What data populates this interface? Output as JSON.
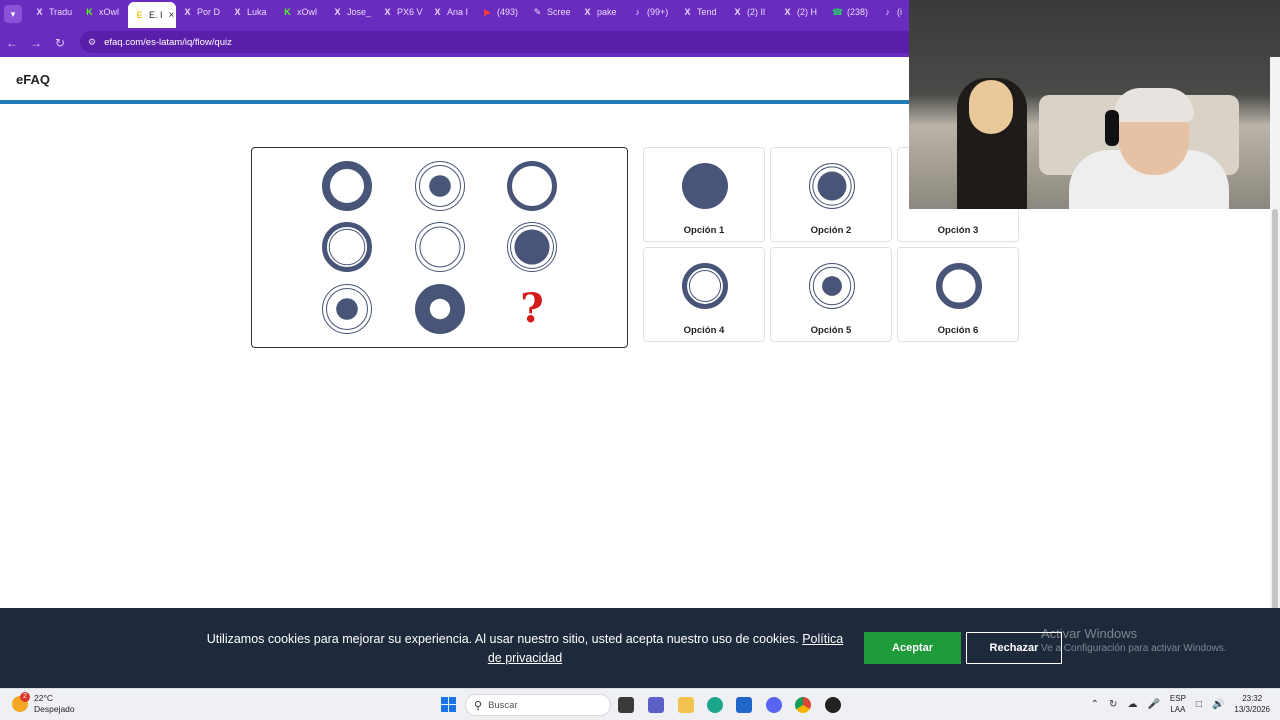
{
  "browser": {
    "tabs": [
      {
        "icon": "x-logo-icon",
        "label": "Tradu"
      },
      {
        "icon": "kick-logo-icon",
        "label": "xOwl"
      },
      {
        "icon": "efaq-logo-icon",
        "label": "E. I",
        "active": true
      },
      {
        "icon": "x-logo-icon",
        "label": "Por D"
      },
      {
        "icon": "x-logo-icon",
        "label": "Luka"
      },
      {
        "icon": "kick-logo-icon",
        "label": "xOwl"
      },
      {
        "icon": "x-logo-icon",
        "label": "Jose_"
      },
      {
        "icon": "x-logo-icon",
        "label": "PX6 V"
      },
      {
        "icon": "x-logo-icon",
        "label": "Ana I"
      },
      {
        "icon": "youtube-logo-icon",
        "label": "(493)"
      },
      {
        "icon": "pen-icon",
        "label": "Scree"
      },
      {
        "icon": "x-logo-icon",
        "label": "pake"
      },
      {
        "icon": "tiktok-logo-icon",
        "label": "(99+)"
      },
      {
        "icon": "x-logo-icon",
        "label": "Tend"
      },
      {
        "icon": "x-logo-icon",
        "label": "(2) Il"
      },
      {
        "icon": "x-logo-icon",
        "label": "(2) H"
      },
      {
        "icon": "whatsapp-logo-icon",
        "label": "(238)"
      },
      {
        "icon": "tiktok-logo-icon",
        "label": "(i"
      }
    ],
    "url": "efaq.com/es-latam/iq/flow/quiz"
  },
  "header": {
    "brand": "eFAQ"
  },
  "puzzle": {
    "cells": [
      {
        "outer": 50,
        "ring": 0.32,
        "inner_gap": 0,
        "core": 0
      },
      {
        "outer": 50,
        "ring": 0.04,
        "inner_gap": 0.1,
        "core": 0.48
      },
      {
        "outer": 50,
        "ring": 0.2,
        "inner_gap": 0,
        "core": 0
      },
      {
        "outer": 50,
        "ring": 0.2,
        "inner_gap": 0.05,
        "core": 0
      },
      {
        "outer": 50,
        "ring": 0.04,
        "inner_gap": 0.12,
        "core": 0
      },
      {
        "outer": 50,
        "ring": 0.04,
        "inner_gap": 0.06,
        "core": 0.78
      },
      {
        "outer": 50,
        "ring": 0.04,
        "inner_gap": 0.1,
        "core": 0.48
      },
      {
        "outer": 50,
        "ring": 1,
        "inner_gap": 0,
        "core": 0,
        "hole": 0.48
      },
      {
        "question": "?"
      }
    ]
  },
  "options": [
    {
      "label": "Opción 1"
    },
    {
      "label": "Opción 2"
    },
    {
      "label": "Opción 3"
    },
    {
      "label": "Opción 4"
    },
    {
      "label": "Opción 5"
    },
    {
      "label": "Opción 6"
    }
  ],
  "colors": {
    "shape": "#485478",
    "accent_rule": "#1f7ab8",
    "question": "#d61a1a",
    "accept": "#1f9b3a",
    "banner": "#1e2a3b"
  },
  "cookie": {
    "message": "Utilizamos cookies para mejorar su experiencia. Al usar nuestro sitio, usted acepta nuestro uso de cookies.",
    "policy_link": "Política de privacidad",
    "accept": "Aceptar",
    "reject": "Rechazar"
  },
  "watermark": {
    "title": "Activar Windows",
    "subtitle": "Ve a Configuración para activar Windows."
  },
  "taskbar": {
    "temp": "22°C",
    "weather": "Despejado",
    "weather_badge": "2",
    "search_placeholder": "Buscar",
    "lang1": "ESP",
    "lang2": "LAA",
    "time": "23:32",
    "date": "13/3/2026"
  }
}
